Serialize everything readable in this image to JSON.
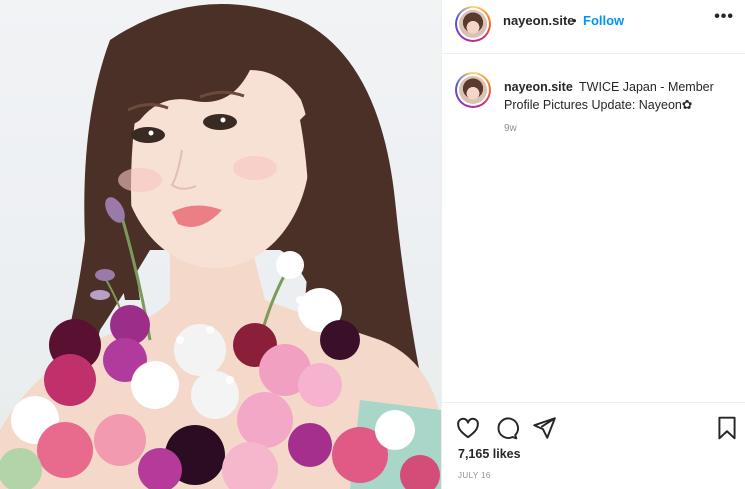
{
  "post": {
    "photo_alt": "Portrait photo holding a bouquet of pink, white and purple flowers",
    "header": {
      "username": "nayeon.site",
      "separator": "•",
      "follow_label": "Follow",
      "more_label": "•••"
    },
    "caption": {
      "username": "nayeon.site",
      "text": "TWICE Japan - Member Profile Pictures Update: Nayeon✿",
      "time_ago": "9w"
    },
    "actions": {
      "like_icon": "heart-icon",
      "comment_icon": "comment-icon",
      "share_icon": "share-icon",
      "save_icon": "bookmark-icon"
    },
    "likes": "7,165 likes",
    "date": "JULY 16"
  },
  "colors": {
    "link": "#0095f6",
    "text": "#262626",
    "muted": "#8e8e8e",
    "divider": "#efefef"
  }
}
